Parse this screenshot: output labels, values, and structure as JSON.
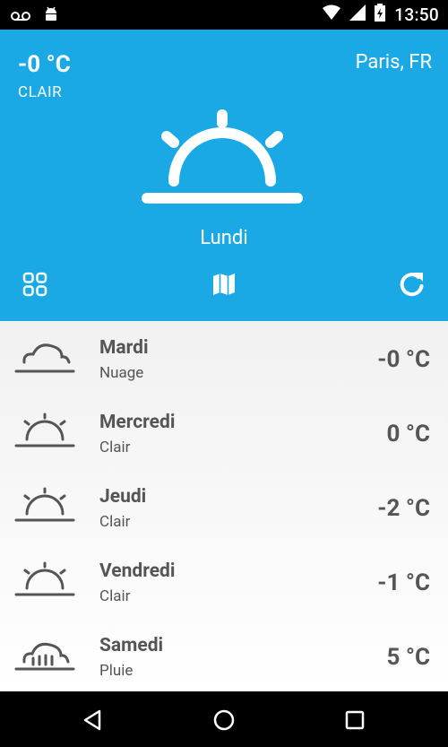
{
  "status_bar": {
    "time": "13:50"
  },
  "header": {
    "current_temp": "-0 °C",
    "current_condition": "CLAIR",
    "location": "Paris, FR",
    "day": "Lundi",
    "icon": "sunrise-icon"
  },
  "forecast": [
    {
      "day": "Mardi",
      "condition": "Nuage",
      "temp": "-0 °C",
      "icon": "cloud-icon"
    },
    {
      "day": "Mercredi",
      "condition": "Clair",
      "temp": "0 °C",
      "icon": "sunrise-icon"
    },
    {
      "day": "Jeudi",
      "condition": "Clair",
      "temp": "-2 °C",
      "icon": "sunrise-icon"
    },
    {
      "day": "Vendredi",
      "condition": "Clair",
      "temp": "-1 °C",
      "icon": "sunrise-icon"
    },
    {
      "day": "Samedi",
      "condition": "Pluie",
      "temp": "5 °C",
      "icon": "rain-cloud-icon"
    }
  ],
  "colors": {
    "header_bg": "#1aa9e5",
    "text_dark": "#555555"
  }
}
